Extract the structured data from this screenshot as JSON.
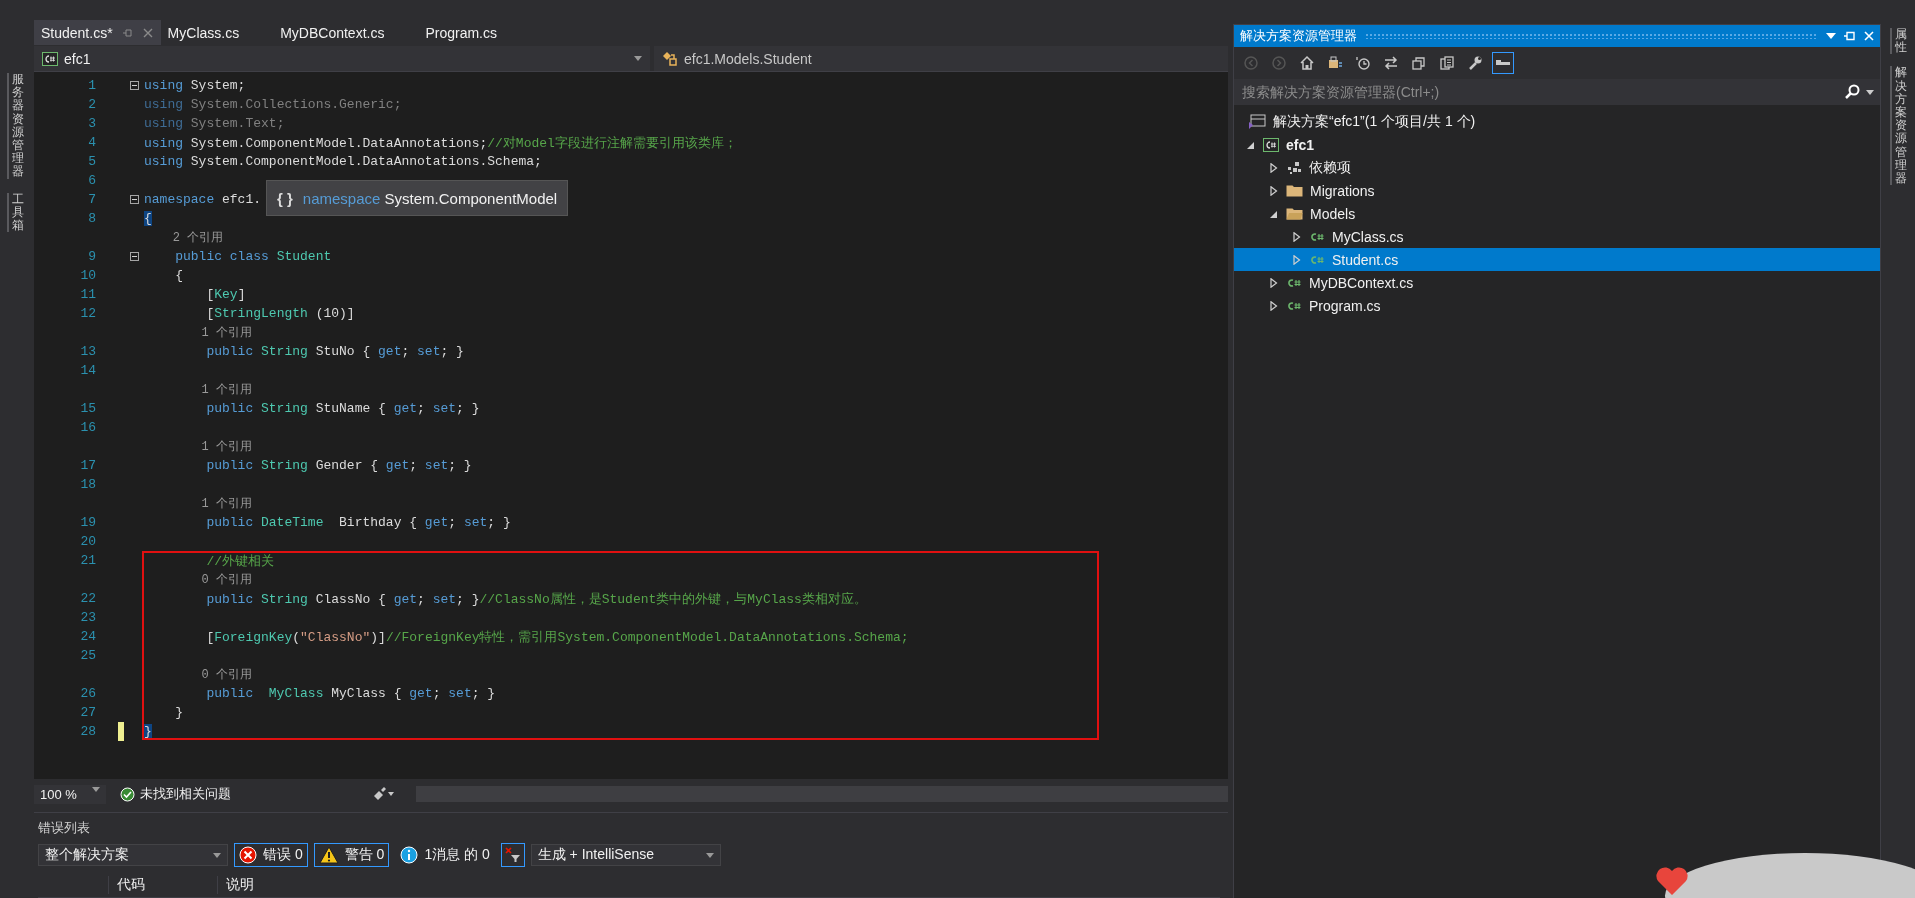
{
  "side_tabs_left": [
    {
      "label": "服务器资源管理器"
    },
    {
      "label": "工具箱"
    }
  ],
  "document_tabs": [
    {
      "label": "Student.cs*",
      "selected": true
    },
    {
      "label": "MyClass.cs",
      "selected": false
    },
    {
      "label": "MyDBContext.cs",
      "selected": false
    },
    {
      "label": "Program.cs",
      "selected": false
    }
  ],
  "navigation_bar": {
    "project": "efc1",
    "type": "efc1.Models.Student"
  },
  "editor": {
    "tooltip": {
      "symbol": "{ }",
      "keyword": "namespace",
      "name": "System.ComponentModel"
    },
    "sections": [
      {
        "boxed": false,
        "rows": [
          {
            "kind": "code",
            "number": "1",
            "collapsible": true,
            "modified": false,
            "segments": [
              {
                "kind": "kw",
                "text": "using"
              },
              {
                "kind": "tx",
                "text": " System;"
              }
            ]
          },
          {
            "kind": "code",
            "number": "2",
            "collapsible": false,
            "modified": false,
            "segments": [
              {
                "kind": "kw-dim",
                "text": "using"
              },
              {
                "kind": "dim",
                "text": " System.Collections.Generic;"
              }
            ]
          },
          {
            "kind": "code",
            "number": "3",
            "collapsible": false,
            "modified": false,
            "segments": [
              {
                "kind": "kw-dim",
                "text": "using"
              },
              {
                "kind": "dim",
                "text": " System.Text;"
              }
            ]
          },
          {
            "kind": "code",
            "number": "4",
            "collapsible": false,
            "modified": false,
            "segments": [
              {
                "kind": "kw",
                "text": "using"
              },
              {
                "kind": "tx",
                "text": " System.ComponentModel.DataAnnotations;"
              },
              {
                "kind": "comment",
                "text": "//对Model字段进行注解需要引用该类库；"
              }
            ]
          },
          {
            "kind": "code",
            "number": "5",
            "collapsible": false,
            "modified": false,
            "segments": [
              {
                "kind": "kw",
                "text": "using"
              },
              {
                "kind": "tx",
                "text": " System.ComponentModel.DataAnnotations.Schema;"
              }
            ]
          },
          {
            "kind": "code",
            "number": "6",
            "collapsible": false,
            "modified": false,
            "segments": []
          },
          {
            "kind": "code",
            "number": "7",
            "collapsible": true,
            "modified": false,
            "segments": [
              {
                "kind": "kw",
                "text": "namespace"
              },
              {
                "kind": "tx",
                "text": " efc1."
              }
            ]
          },
          {
            "kind": "code",
            "number": "8",
            "collapsible": false,
            "modified": false,
            "segments": [
              {
                "kind": "match",
                "text": "{"
              }
            ]
          },
          {
            "kind": "codelens",
            "text": "    2 个引用"
          },
          {
            "kind": "code",
            "number": "9",
            "collapsible": true,
            "modified": false,
            "segments": [
              {
                "kind": "kw",
                "text": "    public class"
              },
              {
                "kind": "type",
                "text": " Student"
              }
            ]
          },
          {
            "kind": "code",
            "number": "10",
            "collapsible": false,
            "modified": false,
            "segments": [
              {
                "kind": "tx",
                "text": "    {"
              }
            ]
          },
          {
            "kind": "code",
            "number": "11",
            "collapsible": false,
            "modified": false,
            "segments": [
              {
                "kind": "tx",
                "text": "        ["
              },
              {
                "kind": "type",
                "text": "Key"
              },
              {
                "kind": "tx",
                "text": "]"
              }
            ]
          },
          {
            "kind": "code",
            "number": "12",
            "collapsible": false,
            "modified": false,
            "segments": [
              {
                "kind": "tx",
                "text": "        ["
              },
              {
                "kind": "type",
                "text": "StringLength"
              },
              {
                "kind": "tx",
                "text": " (10)]"
              }
            ]
          },
          {
            "kind": "codelens",
            "text": "        1 个引用"
          },
          {
            "kind": "code",
            "number": "13",
            "collapsible": false,
            "modified": false,
            "segments": [
              {
                "kind": "kw",
                "text": "        public"
              },
              {
                "kind": "type",
                "text": " String"
              },
              {
                "kind": "tx",
                "text": " StuNo { "
              },
              {
                "kind": "kw",
                "text": "get"
              },
              {
                "kind": "tx",
                "text": "; "
              },
              {
                "kind": "kw",
                "text": "set"
              },
              {
                "kind": "tx",
                "text": "; }"
              }
            ]
          },
          {
            "kind": "code",
            "number": "14",
            "collapsible": false,
            "modified": false,
            "segments": []
          },
          {
            "kind": "codelens",
            "text": "        1 个引用"
          },
          {
            "kind": "code",
            "number": "15",
            "collapsible": false,
            "modified": false,
            "segments": [
              {
                "kind": "kw",
                "text": "        public"
              },
              {
                "kind": "type",
                "text": " String"
              },
              {
                "kind": "tx",
                "text": " StuName { "
              },
              {
                "kind": "kw",
                "text": "get"
              },
              {
                "kind": "tx",
                "text": "; "
              },
              {
                "kind": "kw",
                "text": "set"
              },
              {
                "kind": "tx",
                "text": "; }"
              }
            ]
          },
          {
            "kind": "code",
            "number": "16",
            "collapsible": false,
            "modified": false,
            "segments": []
          },
          {
            "kind": "codelens",
            "text": "        1 个引用"
          },
          {
            "kind": "code",
            "number": "17",
            "collapsible": false,
            "modified": false,
            "segments": [
              {
                "kind": "kw",
                "text": "        public"
              },
              {
                "kind": "type",
                "text": " String"
              },
              {
                "kind": "tx",
                "text": " Gender { "
              },
              {
                "kind": "kw",
                "text": "get"
              },
              {
                "kind": "tx",
                "text": "; "
              },
              {
                "kind": "kw",
                "text": "set"
              },
              {
                "kind": "tx",
                "text": "; }"
              }
            ]
          },
          {
            "kind": "code",
            "number": "18",
            "collapsible": false,
            "modified": false,
            "segments": []
          },
          {
            "kind": "codelens",
            "text": "        1 个引用"
          },
          {
            "kind": "code",
            "number": "19",
            "collapsible": false,
            "modified": false,
            "segments": [
              {
                "kind": "kw",
                "text": "        public"
              },
              {
                "kind": "type",
                "text": " DateTime"
              },
              {
                "kind": "tx",
                "text": "  Birthday { "
              },
              {
                "kind": "kw",
                "text": "get"
              },
              {
                "kind": "tx",
                "text": "; "
              },
              {
                "kind": "kw",
                "text": "set"
              },
              {
                "kind": "tx",
                "text": "; }"
              }
            ]
          },
          {
            "kind": "code",
            "number": "20",
            "collapsible": false,
            "modified": false,
            "segments": []
          }
        ]
      },
      {
        "boxed": true,
        "rows": [
          {
            "kind": "code",
            "number": "21",
            "collapsible": false,
            "modified": false,
            "segments": [
              {
                "kind": "comment",
                "text": "        //外键相关"
              }
            ]
          },
          {
            "kind": "codelens",
            "text": "        0 个引用"
          },
          {
            "kind": "code",
            "number": "22",
            "collapsible": false,
            "modified": false,
            "segments": [
              {
                "kind": "kw",
                "text": "        public"
              },
              {
                "kind": "type",
                "text": " String"
              },
              {
                "kind": "tx",
                "text": " ClassNo { "
              },
              {
                "kind": "kw",
                "text": "get"
              },
              {
                "kind": "tx",
                "text": "; "
              },
              {
                "kind": "kw",
                "text": "set"
              },
              {
                "kind": "tx",
                "text": "; }"
              },
              {
                "kind": "comment",
                "text": "//ClassNo属性，是Student类中的外键，与MyClass类相对应。"
              }
            ]
          },
          {
            "kind": "code",
            "number": "23",
            "collapsible": false,
            "modified": false,
            "segments": []
          },
          {
            "kind": "code",
            "number": "24",
            "collapsible": false,
            "modified": false,
            "segments": [
              {
                "kind": "tx",
                "text": "        ["
              },
              {
                "kind": "type",
                "text": "ForeignKey"
              },
              {
                "kind": "tx",
                "text": "("
              },
              {
                "kind": "string",
                "text": "\"ClassNo\""
              },
              {
                "kind": "tx",
                "text": ")]"
              },
              {
                "kind": "comment",
                "text": "//ForeignKey特性，需引用System.ComponentModel.DataAnnotations.Schema;"
              }
            ]
          },
          {
            "kind": "code",
            "number": "25",
            "collapsible": false,
            "modified": false,
            "segments": []
          },
          {
            "kind": "codelens",
            "text": "        0 个引用"
          },
          {
            "kind": "code",
            "number": "26",
            "collapsible": false,
            "modified": false,
            "segments": [
              {
                "kind": "kw",
                "text": "        public"
              },
              {
                "kind": "type",
                "text": "  MyClass"
              },
              {
                "kind": "tx",
                "text": " MyClass { "
              },
              {
                "kind": "kw",
                "text": "get"
              },
              {
                "kind": "tx",
                "text": "; "
              },
              {
                "kind": "kw",
                "text": "set"
              },
              {
                "kind": "tx",
                "text": "; }"
              }
            ]
          },
          {
            "kind": "code",
            "number": "27",
            "collapsible": false,
            "modified": false,
            "segments": [
              {
                "kind": "tx",
                "text": "    }"
              }
            ]
          },
          {
            "kind": "code",
            "number": "28",
            "collapsible": false,
            "modified": true,
            "segments": [
              {
                "kind": "match",
                "text": "}"
              }
            ]
          }
        ]
      }
    ]
  },
  "editor_status": {
    "zoom": "100 %",
    "issues": "未找到相关问题"
  },
  "error_list": {
    "title": "错误列表",
    "scope": "整个解决方案",
    "filters": [
      {
        "kind": "error",
        "label": "错误 0",
        "selected": true
      },
      {
        "kind": "warning",
        "label": "警告 0",
        "selected": true
      },
      {
        "kind": "info",
        "label": "1消息 的 0",
        "selected": false
      }
    ],
    "source": "生成 + IntelliSense",
    "columns": [
      "代码",
      "说明"
    ]
  },
  "solution_explorer": {
    "title": "解决方案资源管理器",
    "toolbar": [
      {
        "kind": "back",
        "disabled": true,
        "selected": false
      },
      {
        "kind": "forward",
        "disabled": true,
        "selected": false
      },
      {
        "kind": "home",
        "disabled": false,
        "selected": false
      },
      {
        "kind": "sync",
        "disabled": false,
        "selected": false
      },
      {
        "kind": "history",
        "disabled": false,
        "selected": false
      },
      {
        "kind": "swap",
        "disabled": false,
        "selected": false
      },
      {
        "kind": "collapse",
        "disabled": false,
        "selected": false
      },
      {
        "kind": "copy",
        "disabled": false,
        "selected": false
      },
      {
        "kind": "properties",
        "disabled": false,
        "selected": false
      },
      {
        "kind": "preview",
        "disabled": false,
        "selected": true
      }
    ],
    "search": {
      "placeholder": "搜索解决方案资源管理器(Ctrl+;)"
    },
    "solution": {
      "label": "解决方案“efc1”(1 个项目/共 1 个)",
      "children": [
        {
          "label": "efc1",
          "kind": "project",
          "expanded": true,
          "selected": false,
          "children": [
            {
              "label": "依赖项",
              "kind": "dependencies",
              "expanded": false,
              "selected": false
            },
            {
              "label": "Migrations",
              "kind": "folder",
              "expanded": false,
              "selected": false
            },
            {
              "label": "Models",
              "kind": "folder",
              "expanded": true,
              "selected": false,
              "children": [
                {
                  "label": "MyClass.cs",
                  "kind": "file",
                  "expanded": false,
                  "selected": false
                },
                {
                  "label": "Student.cs",
                  "kind": "file",
                  "expanded": false,
                  "selected": true
                }
              ]
            },
            {
              "label": "MyDBContext.cs",
              "kind": "file",
              "expanded": false,
              "selected": false
            },
            {
              "label": "Program.cs",
              "kind": "file",
              "expanded": false,
              "selected": false
            }
          ]
        }
      ]
    }
  },
  "side_tabs_right": [
    {
      "label": "属性"
    },
    {
      "label": "解决方案资源管理器"
    }
  ]
}
